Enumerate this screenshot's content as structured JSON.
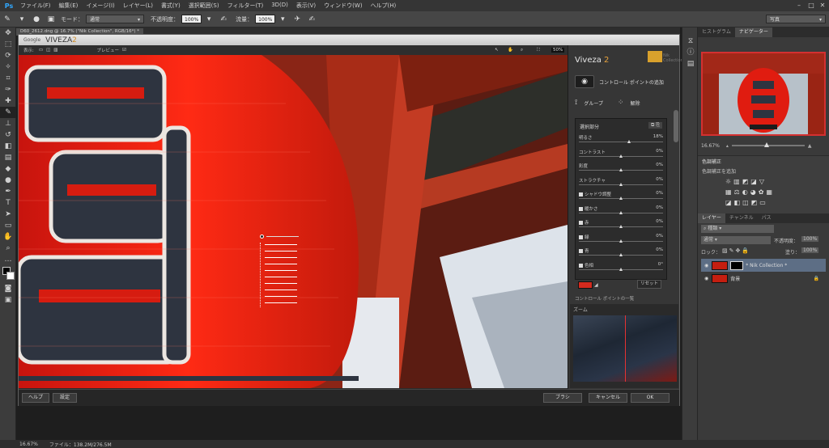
{
  "app": {
    "logo": "Ps"
  },
  "menu": [
    "ファイル(F)",
    "編集(E)",
    "イメージ(I)",
    "レイヤー(L)",
    "書式(Y)",
    "選択範囲(S)",
    "フィルター(T)",
    "3D(D)",
    "表示(V)",
    "ウィンドウ(W)",
    "ヘルプ(H)"
  ],
  "options": {
    "mode_label": "モード：",
    "mode_value": "通常",
    "opacity_label": "不透明度：",
    "opacity_value": "100%",
    "flow_label": "流量：",
    "flow_value": "100%",
    "workspace": "写真"
  },
  "doc_tab": "D60_2612.dng @ 16.7% (\"Nik Collection\", RGB/16*) *",
  "viveza": {
    "brand_google": "Google",
    "brand_name": "VIVEZA",
    "brand_ver": "2",
    "view_label": "表示:",
    "preview_label": "プレビュー",
    "zoom_pct": "50%",
    "panel_title": "Viveza",
    "panel_ver": "2",
    "nik_label": "Nik Collection",
    "add_cp_label": "コントロール ポイントの追加",
    "group_label": "グループ",
    "ungroup_label": "解除",
    "selection_label": "選択部分",
    "sliders": [
      {
        "name": "明るさ",
        "value": "18%",
        "pos": 0.6,
        "check": false
      },
      {
        "name": "コントラスト",
        "value": "0%",
        "pos": 0.5,
        "check": false
      },
      {
        "name": "彩度",
        "value": "0%",
        "pos": 0.5,
        "check": false
      },
      {
        "name": "ストラクチャ",
        "value": "0%",
        "pos": 0.5,
        "check": false
      },
      {
        "name": "シャドウ調整",
        "value": "0%",
        "pos": 0.5,
        "check": true
      },
      {
        "name": "暖かさ",
        "value": "0%",
        "pos": 0.5,
        "check": true
      },
      {
        "name": "赤",
        "value": "0%",
        "pos": 0.5,
        "check": true
      },
      {
        "name": "緑",
        "value": "0%",
        "pos": 0.5,
        "check": true
      },
      {
        "name": "青",
        "value": "0%",
        "pos": 0.5,
        "check": true
      },
      {
        "name": "色相",
        "value": "0°",
        "pos": 0.5,
        "check": true
      }
    ],
    "reset_label": "リセット",
    "cp_list_label": "コントロール ポイントの一覧",
    "zoom_label": "ズーム",
    "help_btn": "ヘルプ",
    "settings_btn": "設定",
    "brush_btn": "ブラシ",
    "cancel_btn": "キャンセル",
    "ok_btn": "OK",
    "swatch_color": "#d42a1e"
  },
  "panels": {
    "tabs_top": [
      "ヒストグラム",
      "ナビゲーター"
    ],
    "nav_zoom": "16.67%",
    "adjust_title": "色調補正",
    "adjust_add": "色調補正を追加",
    "tabs_layers": [
      "レイヤー",
      "チャンネル",
      "パス"
    ],
    "kind_label": "種類",
    "blend_mode": "通常",
    "opacity_label": "不透明度：",
    "opacity_value": "100%",
    "lock_label": "ロック：",
    "fill_label": "塗り：",
    "fill_value": "100%",
    "layers": [
      {
        "name": "* Nik Collection *",
        "selected": true
      },
      {
        "name": "背景",
        "selected": false
      }
    ]
  },
  "status": {
    "zoom": "16.67%",
    "file": "ファイル：138.2M/276.5M"
  }
}
